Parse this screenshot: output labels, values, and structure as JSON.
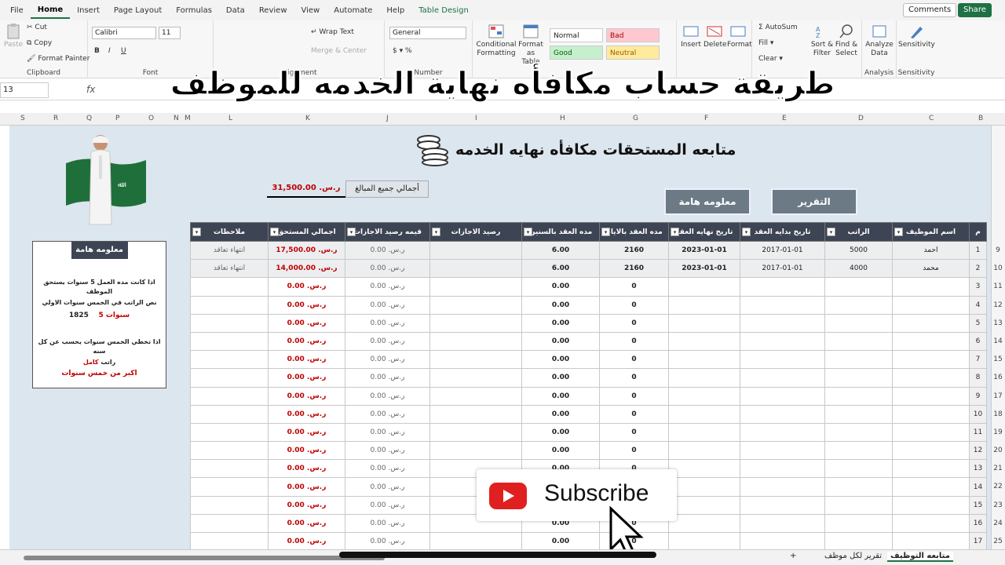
{
  "menu": {
    "tabs": [
      "File",
      "Home",
      "Insert",
      "Page Layout",
      "Formulas",
      "Data",
      "Review",
      "View",
      "Automate",
      "Help",
      "Table Design"
    ],
    "active": "Home",
    "comments": "Comments",
    "share": "Share"
  },
  "ribbon": {
    "clipboard": {
      "paste": "Paste",
      "cut": "Cut",
      "copy": "Copy",
      "format_painter": "Format Painter",
      "label": "Clipboard"
    },
    "font": {
      "name": "Calibri",
      "size": "11",
      "label": "Font"
    },
    "alignment": {
      "wrap_text": "Wrap Text",
      "merge_center": "Merge & Center",
      "label": "Alignment"
    },
    "number": {
      "format": "General",
      "label": "Number"
    },
    "styles": {
      "conditional": "Conditional",
      "formatting": "Formatting",
      "format_as": "Format as",
      "table": "Table",
      "normal": "Normal",
      "bad": "Bad",
      "good": "Good",
      "neutral": "Neutral"
    },
    "cells": {
      "insert": "Insert",
      "delete": "Delete",
      "format": "Format"
    },
    "editing": {
      "autosum": "AutoSum",
      "fill": "Fill",
      "clear": "Clear",
      "sort": "Sort &",
      "filter": "Filter",
      "find": "Find &",
      "select": "Select"
    },
    "analysis": {
      "analyze": "Analyze",
      "data": "Data",
      "label": "Analysis"
    },
    "sensitivity": {
      "label": "Sensitivity",
      "btn": "Sensitivity"
    }
  },
  "formula_bar": {
    "namebox": "13",
    "fx": "fx"
  },
  "overlay_title": "طريقة حساب مكافأه نهاية الخدمه للموظف",
  "columns": [
    "S",
    "R",
    "Q",
    "P",
    "O",
    "N",
    "M",
    "L",
    "K",
    "J",
    "I",
    "H",
    "G",
    "F",
    "E",
    "D",
    "C",
    "B"
  ],
  "sheet": {
    "title": "متابعه المستحقات مكافأه نهايه الخدمه",
    "total_label": "أجمالي جميع المبالغ",
    "total_value": "31,500.00 .ر.س",
    "report_btn": "التقرير",
    "info_btn": "معلومه هامة"
  },
  "note": {
    "header": "معلومه هامة",
    "line1": "اذا كانت مده العمل 5 سنوات يستحق الموظف",
    "line2": "نص الراتب في الخمس سنوات الاولي",
    "years_label": "سنوات 5",
    "days": "1825",
    "line3": "اذا تخطي الخمس سنوات يحسب عن كل سنه",
    "line4_a": "راتب",
    "line4_b": "كامل",
    "line5": "اكبر من خمس سنوات"
  },
  "table": {
    "headers": [
      "ملاحظات",
      "اجمالي المستحق",
      "قيمه رصيد الاجازات",
      "رصيد الاجازات",
      "مده العقد بالسنين",
      "مده العقد بالايام",
      "تاريخ نهايه العقد",
      "تاريخ بدايه العقد",
      "الراتب",
      "اسم الموظيف",
      "م"
    ],
    "rows": [
      {
        "note": "انتهاء تعاقد",
        "total": "17,500.00 .ر.س",
        "leave_val": "0.00 .ر.س",
        "leave": "",
        "years": "6.00",
        "days": "2160",
        "end": "2023-01-01",
        "start": "2017-01-01",
        "salary": "5000",
        "name": "احمد",
        "n": "1"
      },
      {
        "note": "انتهاء تعاقد",
        "total": "14,000.00 .ر.س",
        "leave_val": "0.00 .ر.س",
        "leave": "",
        "years": "6.00",
        "days": "2160",
        "end": "2023-01-01",
        "start": "2017-01-01",
        "salary": "4000",
        "name": "محمد",
        "n": "2"
      },
      {
        "note": "",
        "total": "0.00 .ر.س",
        "leave_val": "0.00 .ر.س",
        "leave": "",
        "years": "0.00",
        "days": "0",
        "end": "",
        "start": "",
        "salary": "",
        "name": "",
        "n": "3"
      },
      {
        "note": "",
        "total": "0.00 .ر.س",
        "leave_val": "0.00 .ر.س",
        "leave": "",
        "years": "0.00",
        "days": "0",
        "end": "",
        "start": "",
        "salary": "",
        "name": "",
        "n": "4"
      },
      {
        "note": "",
        "total": "0.00 .ر.س",
        "leave_val": "0.00 .ر.س",
        "leave": "",
        "years": "0.00",
        "days": "0",
        "end": "",
        "start": "",
        "salary": "",
        "name": "",
        "n": "5"
      },
      {
        "note": "",
        "total": "0.00 .ر.س",
        "leave_val": "0.00 .ر.س",
        "leave": "",
        "years": "0.00",
        "days": "0",
        "end": "",
        "start": "",
        "salary": "",
        "name": "",
        "n": "6"
      },
      {
        "note": "",
        "total": "0.00 .ر.س",
        "leave_val": "0.00 .ر.س",
        "leave": "",
        "years": "0.00",
        "days": "0",
        "end": "",
        "start": "",
        "salary": "",
        "name": "",
        "n": "7"
      },
      {
        "note": "",
        "total": "0.00 .ر.س",
        "leave_val": "0.00 .ر.س",
        "leave": "",
        "years": "0.00",
        "days": "0",
        "end": "",
        "start": "",
        "salary": "",
        "name": "",
        "n": "8"
      },
      {
        "note": "",
        "total": "0.00 .ر.س",
        "leave_val": "0.00 .ر.س",
        "leave": "",
        "years": "0.00",
        "days": "0",
        "end": "",
        "start": "",
        "salary": "",
        "name": "",
        "n": "9"
      },
      {
        "note": "",
        "total": "0.00 .ر.س",
        "leave_val": "0.00 .ر.س",
        "leave": "",
        "years": "0.00",
        "days": "0",
        "end": "",
        "start": "",
        "salary": "",
        "name": "",
        "n": "10"
      },
      {
        "note": "",
        "total": "0.00 .ر.س",
        "leave_val": "0.00 .ر.س",
        "leave": "",
        "years": "0.00",
        "days": "0",
        "end": "",
        "start": "",
        "salary": "",
        "name": "",
        "n": "11"
      },
      {
        "note": "",
        "total": "0.00 .ر.س",
        "leave_val": "0.00 .ر.س",
        "leave": "",
        "years": "0.00",
        "days": "0",
        "end": "",
        "start": "",
        "salary": "",
        "name": "",
        "n": "12"
      },
      {
        "note": "",
        "total": "0.00 .ر.س",
        "leave_val": "0.00 .ر.س",
        "leave": "",
        "years": "0.00",
        "days": "0",
        "end": "",
        "start": "",
        "salary": "",
        "name": "",
        "n": "13"
      },
      {
        "note": "",
        "total": "0.00 .ر.س",
        "leave_val": "0.00 .ر.س",
        "leave": "",
        "years": "0.00",
        "days": "0",
        "end": "",
        "start": "",
        "salary": "",
        "name": "",
        "n": "14"
      },
      {
        "note": "",
        "total": "0.00 .ر.س",
        "leave_val": "0.00 .ر.س",
        "leave": "",
        "years": "0.00",
        "days": "0",
        "end": "",
        "start": "",
        "salary": "",
        "name": "",
        "n": "15"
      },
      {
        "note": "",
        "total": "0.00 .ر.س",
        "leave_val": "0.00 .ر.س",
        "leave": "",
        "years": "0.00",
        "days": "0",
        "end": "",
        "start": "",
        "salary": "",
        "name": "",
        "n": "16"
      },
      {
        "note": "",
        "total": "0.00 .ر.س",
        "leave_val": "0.00 .ر.س",
        "leave": "",
        "years": "0.00",
        "days": "0",
        "end": "",
        "start": "",
        "salary": "",
        "name": "",
        "n": "17"
      }
    ],
    "excel_rows": [
      "9",
      "10",
      "11",
      "12",
      "13",
      "14",
      "15",
      "16",
      "17",
      "18",
      "19",
      "20",
      "21",
      "22",
      "23",
      "24",
      "25"
    ]
  },
  "subscribe": "Subscribe",
  "sheet_tabs": {
    "active": "متابعه التوظيف",
    "other": "تقرير لكل موظف",
    "add": "+"
  },
  "colors": {
    "accent": "#1e7145",
    "header_dark": "#3d4454",
    "money_red": "#c00000",
    "sheet_bg": "#dce6ee"
  }
}
